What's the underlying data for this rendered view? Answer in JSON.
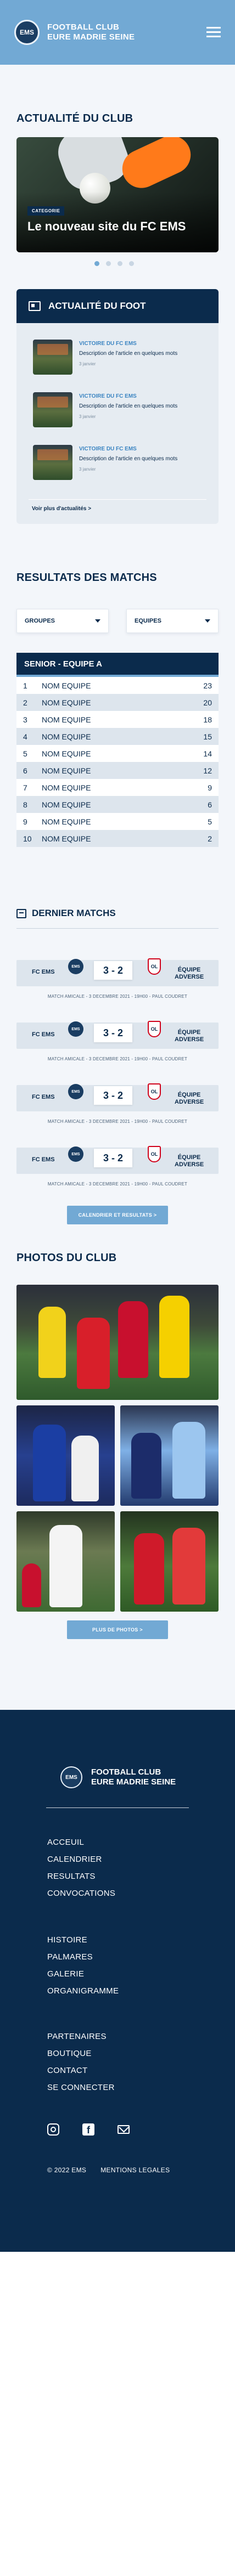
{
  "header": {
    "club_name_line1": "FOOTBALL CLUB",
    "club_name_line2": "EURE MADRIE SEINE",
    "crest_text": "EMS"
  },
  "news_section": {
    "title": "ACTUALITÉ DU CLUB",
    "hero": {
      "category": "CATEGORIE",
      "headline": "Le nouveau site du FC EMS"
    },
    "carousel_dots": 4,
    "active_dot": 0
  },
  "foot_news": {
    "title": "ACTUALITÉ DU FOOT",
    "items": [
      {
        "kicker": "VICTOIRE DU FC EMS",
        "description": "Description de l'article en quelques mots",
        "date": "3 janvier"
      },
      {
        "kicker": "VICTOIRE DU FC EMS",
        "description": "Description de l'article en quelques mots",
        "date": "3 janvier"
      },
      {
        "kicker": "VICTOIRE DU FC EMS",
        "description": "Description de l'article en quelques mots",
        "date": "3 janvier"
      }
    ],
    "more_link": "Voir plus d'actualités  >"
  },
  "results": {
    "title": "RESULTATS DES MATCHS",
    "filter_groups": "GROUPES",
    "filter_teams": "EQUIPES",
    "table_title": "SENIOR - EQUIPE A",
    "rows": [
      {
        "rank": "1",
        "team": "NOM EQUIPE",
        "points": "23"
      },
      {
        "rank": "2",
        "team": "NOM EQUIPE",
        "points": "20"
      },
      {
        "rank": "3",
        "team": "NOM EQUIPE",
        "points": "18"
      },
      {
        "rank": "4",
        "team": "NOM EQUIPE",
        "points": "15"
      },
      {
        "rank": "5",
        "team": "NOM EQUIPE",
        "points": "14"
      },
      {
        "rank": "6",
        "team": "NOM EQUIPE",
        "points": "12"
      },
      {
        "rank": "7",
        "team": "NOM EQUIPE",
        "points": "9"
      },
      {
        "rank": "8",
        "team": "NOM EQUIPE",
        "points": "6"
      },
      {
        "rank": "9",
        "team": "NOM EQUIPE",
        "points": "5"
      },
      {
        "rank": "10",
        "team": "NOM EQUIPE",
        "points": "2"
      }
    ]
  },
  "last_matches": {
    "title": "DERNIER MATCHS",
    "matches": [
      {
        "home": "FC EMS",
        "home_crest": "EMS",
        "score": "3 - 2",
        "away_crest": "OL",
        "away_line1": "ÉQUIPE",
        "away_line2": "ADVERSE",
        "meta": "MATCH AMICALE - 3 DECEMBRE 2021 - 19H00 - PAUL COUDRET"
      },
      {
        "home": "FC EMS",
        "home_crest": "EMS",
        "score": "3 - 2",
        "away_crest": "OL",
        "away_line1": "ÉQUIPE",
        "away_line2": "ADVERSE",
        "meta": "MATCH AMICALE - 3 DECEMBRE 2021 - 19H00 - PAUL COUDRET"
      },
      {
        "home": "FC EMS",
        "home_crest": "EMS",
        "score": "3 - 2",
        "away_crest": "OL",
        "away_line1": "ÉQUIPE",
        "away_line2": "ADVERSE",
        "meta": "MATCH AMICALE - 3 DECEMBRE 2021 - 19H00 - PAUL COUDRET"
      },
      {
        "home": "FC EMS",
        "home_crest": "EMS",
        "score": "3 - 2",
        "away_crest": "OL",
        "away_line1": "ÉQUIPE",
        "away_line2": "ADVERSE",
        "meta": "MATCH AMICALE - 3 DECEMBRE 2021 - 19H00 - PAUL COUDRET"
      }
    ],
    "button": "CALENDRIER ET RESULTATS  >"
  },
  "photos": {
    "title": "PHOTOS DU CLUB",
    "button": "PLUS DE PHOTOS  >"
  },
  "footer": {
    "club_name_line1": "FOOTBALL CLUB",
    "club_name_line2": "EURE MADRIE SEINE",
    "crest_text": "EMS",
    "links_group1": [
      "ACCEUIL",
      "CALENDRIER",
      "RESULTATS",
      "CONVOCATIONS"
    ],
    "links_group2": [
      "HISTOIRE",
      "PALMARES",
      "GALERIE",
      "ORGANIGRAMME"
    ],
    "links_group3": [
      "PARTENAIRES",
      "BOUTIQUE",
      "CONTACT",
      "SE CONNECTER"
    ],
    "copyright": "© 2022 EMS",
    "legal": "MENTIONS LEGALES"
  },
  "colors": {
    "navy": "#0b2b4c",
    "accent": "#72a9d4",
    "light": "#f3f6fa"
  }
}
